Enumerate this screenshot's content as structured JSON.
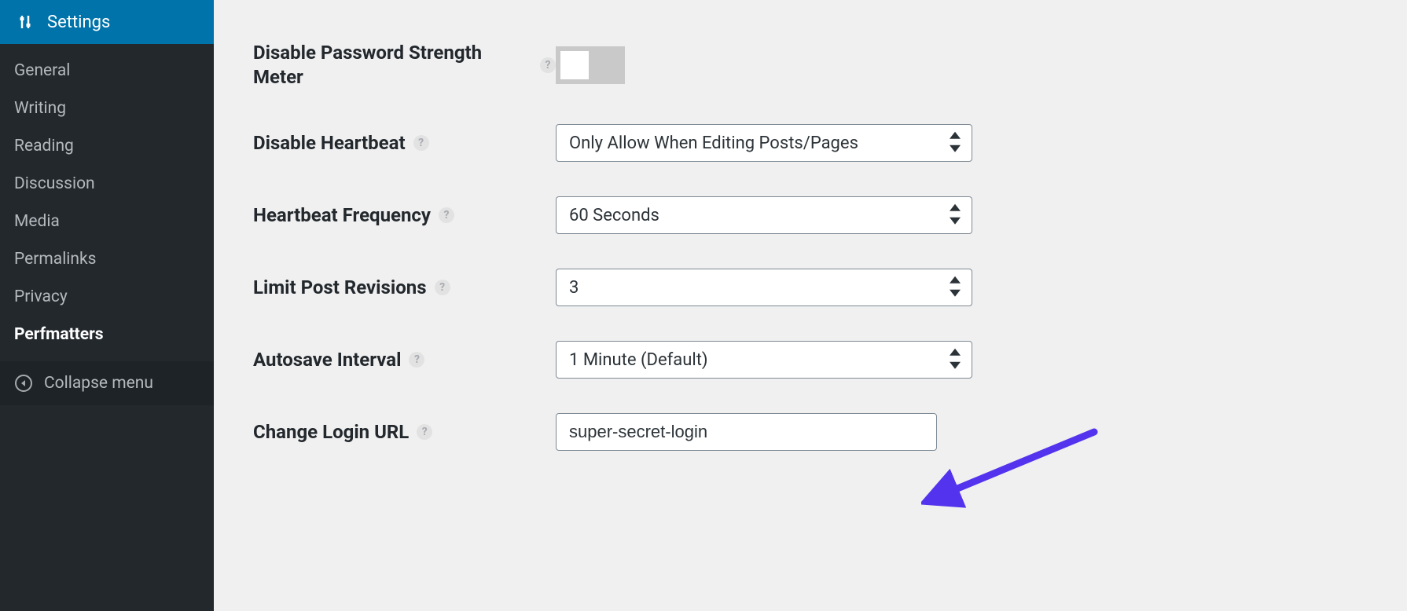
{
  "sidebar": {
    "title": "Settings",
    "items": [
      {
        "label": "General"
      },
      {
        "label": "Writing"
      },
      {
        "label": "Reading"
      },
      {
        "label": "Discussion"
      },
      {
        "label": "Media"
      },
      {
        "label": "Permalinks"
      },
      {
        "label": "Privacy"
      },
      {
        "label": "Perfmatters"
      }
    ],
    "collapse_label": "Collapse menu"
  },
  "settings": {
    "disable_password_meter": {
      "label": "Disable Password Strength Meter"
    },
    "disable_heartbeat": {
      "label": "Disable Heartbeat",
      "value": "Only Allow When Editing Posts/Pages"
    },
    "heartbeat_frequency": {
      "label": "Heartbeat Frequency",
      "value": "60 Seconds"
    },
    "limit_post_revisions": {
      "label": "Limit Post Revisions",
      "value": "3"
    },
    "autosave_interval": {
      "label": "Autosave Interval",
      "value": "1 Minute (Default)"
    },
    "change_login_url": {
      "label": "Change Login URL",
      "value": "super-secret-login"
    }
  },
  "colors": {
    "accent": "#0073aa",
    "sidebar_bg": "#23282d",
    "annotation": "#5333ed"
  }
}
